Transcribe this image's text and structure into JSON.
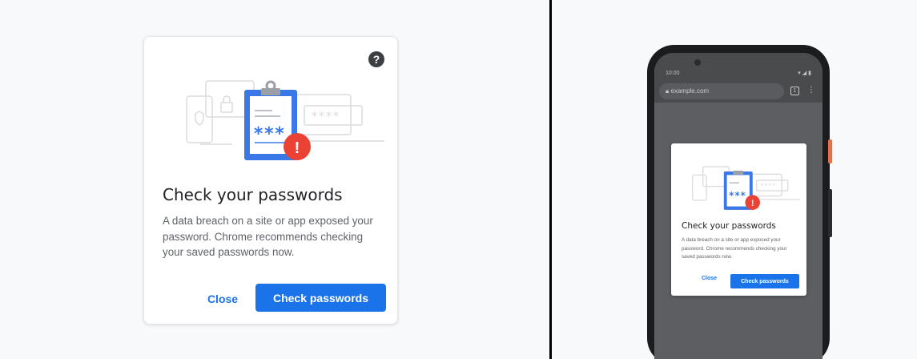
{
  "dialog": {
    "title": "Check your passwords",
    "body": "A data breach on a site or app exposed your password. Chrome recommends checking your saved passwords now.",
    "close_label": "Close",
    "primary_label": "Check passwords",
    "help_icon": "help-circle-icon",
    "illustration_masked_text": "***",
    "illustration_field_text": "****",
    "alert_glyph": "!",
    "colors": {
      "primary": "#1a73e8",
      "alert": "#ea4335",
      "clipboard": "#3b78e7"
    }
  },
  "phone": {
    "status_time": "10:00",
    "url": "example.com",
    "tab_count": "1",
    "dialog": {
      "title": "Check your passwords",
      "body": "A data breach on a site or app exposed your password. Chrome recommends checking your saved passwords now.",
      "close_label": "Close",
      "primary_label": "Check passwords"
    }
  }
}
